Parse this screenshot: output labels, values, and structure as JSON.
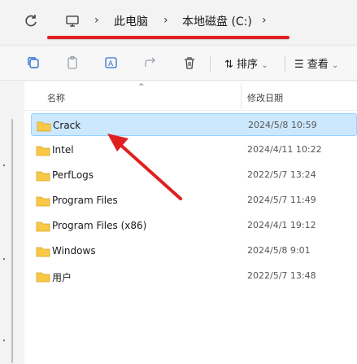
{
  "address_bar": {
    "refresh_icon": "refresh-icon",
    "computer_icon": "computer-icon",
    "breadcrumbs": [
      "此电脑",
      "本地磁盘 (C:)"
    ]
  },
  "toolbar": {
    "icons": [
      "new-window-icon",
      "copy-icon",
      "rename-icon",
      "share-icon",
      "delete-icon"
    ],
    "sort_label": "排序",
    "view_label": "查看"
  },
  "file_list": {
    "columns": {
      "name": "名称",
      "date_modified": "修改日期"
    },
    "rows": [
      {
        "name": "Crack",
        "date": "2024/5/8 10:59",
        "selected": true
      },
      {
        "name": "Intel",
        "date": "2024/4/11 10:22",
        "selected": false
      },
      {
        "name": "PerfLogs",
        "date": "2022/5/7 13:24",
        "selected": false
      },
      {
        "name": "Program Files",
        "date": "2024/5/7 11:49",
        "selected": false
      },
      {
        "name": "Program Files (x86)",
        "date": "2024/4/1 19:12",
        "selected": false
      },
      {
        "name": "Windows",
        "date": "2024/5/8 9:01",
        "selected": false
      },
      {
        "name": "用户",
        "date": "2022/5/7 13:48",
        "selected": false
      }
    ]
  },
  "colors": {
    "accent_red": "#e02020",
    "selection_bg": "#cce8ff",
    "folder_yellow": "#f8c846"
  }
}
